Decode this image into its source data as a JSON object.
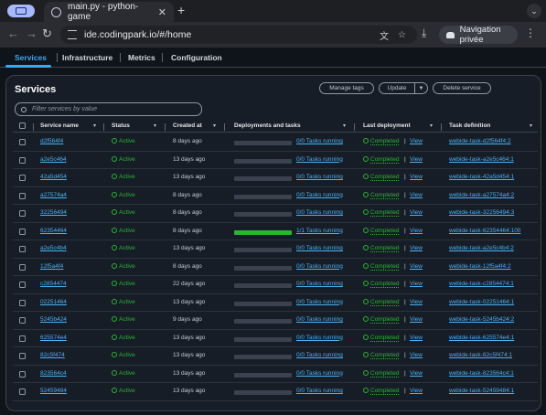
{
  "browser": {
    "tab_title": "main.py - python-game",
    "url": "ide.codingpark.io/#/home",
    "profile_label": "Navigation privée"
  },
  "icons": {
    "app": "window-icon",
    "tab": "globe-icon",
    "close": "close-icon",
    "new_tab": "plus-icon",
    "back": "arrow-left-icon",
    "forward": "arrow-right-icon",
    "reload": "reload-icon",
    "site_info": "tune-icon",
    "translate": "translate-icon",
    "bookmark": "star-icon",
    "download": "download-icon",
    "incognito": "incognito-icon",
    "menu": "kebab-menu-icon",
    "search": "search-icon"
  },
  "console_tabs": [
    "Services",
    "Infrastructure",
    "Metrics",
    "Configuration"
  ],
  "panel": {
    "title": "Services",
    "buttons": {
      "manage_tags": "Manage tags",
      "update": "Update",
      "delete": "Delete service"
    },
    "search_placeholder": "Filter services by value"
  },
  "columns": [
    "Service name",
    "Status",
    "Created at",
    "Deployments and tasks",
    "Last deployment",
    "Task definition"
  ],
  "rows": [
    {
      "name": "d2f564f4",
      "status": "Active",
      "created": "8 days ago",
      "progress": 0,
      "tasks": "0/0 Tasks running",
      "deploy": "Completed",
      "view": "View",
      "taskdef": "webide-task-d2f564f4:2"
    },
    {
      "name": "a2e5c464",
      "status": "Active",
      "created": "13 days ago",
      "progress": 0,
      "tasks": "0/0 Tasks running",
      "deploy": "Completed",
      "view": "View",
      "taskdef": "webide-task-a2e5c464:1"
    },
    {
      "name": "42a5d454",
      "status": "Active",
      "created": "13 days ago",
      "progress": 0,
      "tasks": "0/0 Tasks running",
      "deploy": "Completed",
      "view": "View",
      "taskdef": "webide-task-42a5d454:1"
    },
    {
      "name": "a27574a4",
      "status": "Active",
      "created": "8 days ago",
      "progress": 0,
      "tasks": "0/0 Tasks running",
      "deploy": "Completed",
      "view": "View",
      "taskdef": "webide-task-a27574a4:2"
    },
    {
      "name": "32256494",
      "status": "Active",
      "created": "8 days ago",
      "progress": 0,
      "tasks": "0/0 Tasks running",
      "deploy": "Completed",
      "view": "View",
      "taskdef": "webide-task-32256494:3"
    },
    {
      "name": "62354464",
      "status": "Active",
      "created": "8 days ago",
      "progress": 1,
      "tasks": "1/1 Tasks running",
      "deploy": "Completed",
      "view": "View",
      "taskdef": "webide-task-62354464:100"
    },
    {
      "name": "a2e5c4b4",
      "status": "Active",
      "created": "13 days ago",
      "progress": 0,
      "tasks": "0/0 Tasks running",
      "deploy": "Completed",
      "view": "View",
      "taskdef": "webide-task-a2e5c4b4:2"
    },
    {
      "name": "12f5a4f4",
      "status": "Active",
      "created": "8 days ago",
      "progress": 0,
      "tasks": "0/0 Tasks running",
      "deploy": "Completed",
      "view": "View",
      "taskdef": "webide-task-12f5a4f4:2"
    },
    {
      "name": "c2854474",
      "status": "Active",
      "created": "22 days ago",
      "progress": 0,
      "tasks": "0/0 Tasks running",
      "deploy": "Completed",
      "view": "View",
      "taskdef": "webide-task-c2854474:1"
    },
    {
      "name": "02251464",
      "status": "Active",
      "created": "13 days ago",
      "progress": 0,
      "tasks": "0/0 Tasks running",
      "deploy": "Completed",
      "view": "View",
      "taskdef": "webide-task-02251464:1"
    },
    {
      "name": "5245b424",
      "status": "Active",
      "created": "9 days ago",
      "progress": 0,
      "tasks": "0/0 Tasks running",
      "deploy": "Completed",
      "view": "View",
      "taskdef": "webide-task-5245b424:2"
    },
    {
      "name": "625574e4",
      "status": "Active",
      "created": "13 days ago",
      "progress": 0,
      "tasks": "0/0 Tasks running",
      "deploy": "Completed",
      "view": "View",
      "taskdef": "webide-task-625574e4:1"
    },
    {
      "name": "82c5f474",
      "status": "Active",
      "created": "13 days ago",
      "progress": 0,
      "tasks": "0/0 Tasks running",
      "deploy": "Completed",
      "view": "View",
      "taskdef": "webide-task-82c5f474:1"
    },
    {
      "name": "823564c4",
      "status": "Active",
      "created": "13 days ago",
      "progress": 0,
      "tasks": "0/0 Tasks running",
      "deploy": "Completed",
      "view": "View",
      "taskdef": "webide-task-823564c4:1"
    },
    {
      "name": "52459484",
      "status": "Active",
      "created": "13 days ago",
      "progress": 0,
      "tasks": "0/0 Tasks running",
      "deploy": "Completed",
      "view": "View",
      "taskdef": "webide-task-52459484:1"
    }
  ],
  "colors": {
    "accent": "#39a8f3",
    "success": "#2bb534",
    "link": "#4db1f4"
  }
}
